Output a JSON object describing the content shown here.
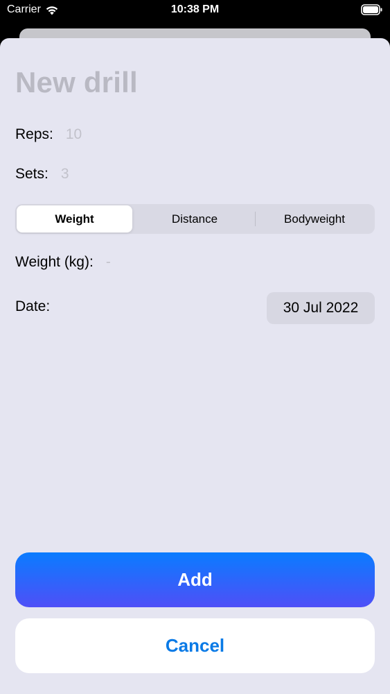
{
  "status_bar": {
    "carrier": "Carrier",
    "time": "10:38 PM",
    "icons": [
      "wifi-icon",
      "battery-icon"
    ]
  },
  "form": {
    "title": "New drill",
    "reps_label": "Reps:",
    "reps_value": "10",
    "sets_label": "Sets:",
    "sets_value": "3",
    "segments": [
      "Weight",
      "Distance",
      "Bodyweight"
    ],
    "selected_segment": "Weight",
    "weight_label": "Weight (kg):",
    "weight_value": "-",
    "date_label": "Date:",
    "date_value": "30 Jul 2022"
  },
  "actions": {
    "add_label": "Add",
    "cancel_label": "Cancel"
  },
  "colors": {
    "sheet_background": "#e5e5f1",
    "accent_start": "#0a7cff",
    "accent_end": "#4f4ff7",
    "cancel_text": "#0a7ae6",
    "placeholder": "#c2c2cb"
  }
}
